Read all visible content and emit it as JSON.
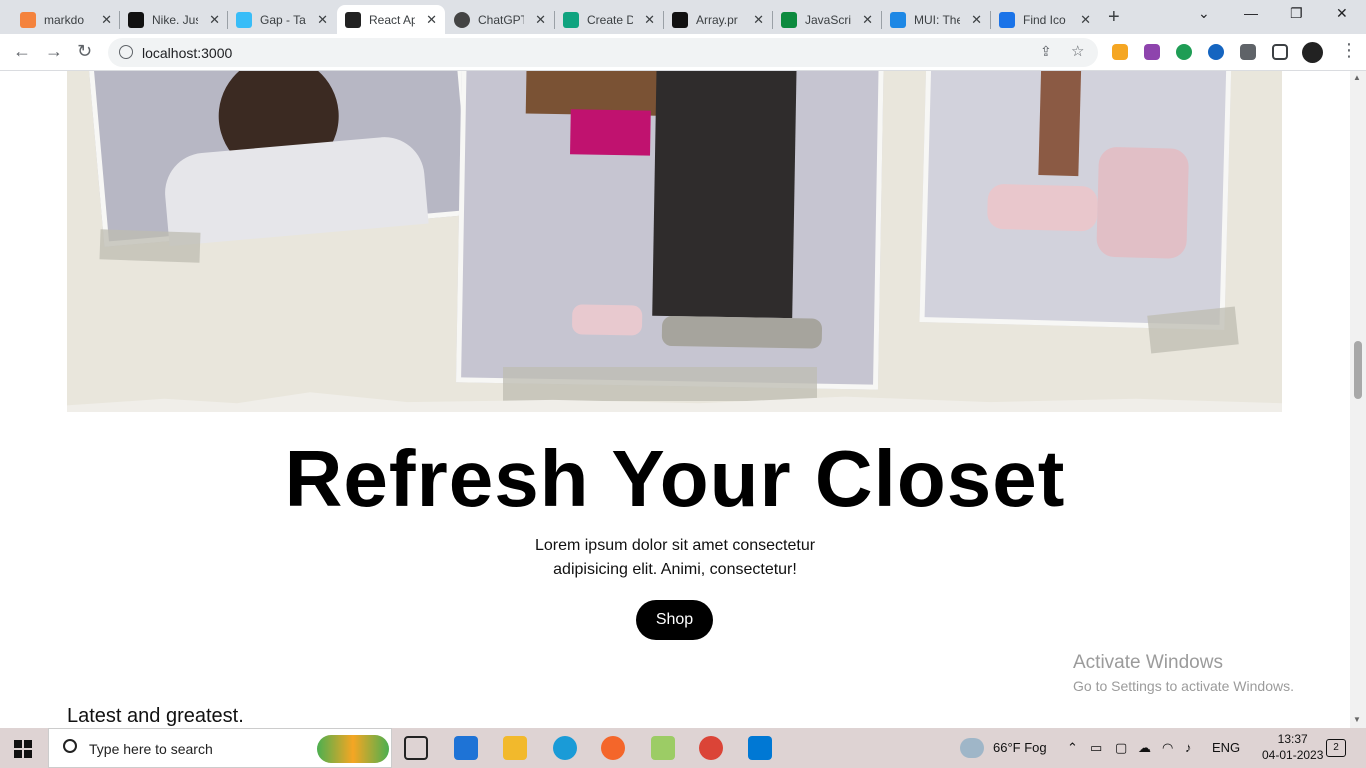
{
  "browser": {
    "tabs": [
      {
        "label": "markdo",
        "color": "#f4833d"
      },
      {
        "label": "Nike. Jus",
        "color": "#111111"
      },
      {
        "label": "Gap - Ta",
        "color": "#38bdf8"
      },
      {
        "label": "React Ap",
        "color": "#222222"
      },
      {
        "label": "ChatGPT",
        "color": "#444444"
      },
      {
        "label": "Create D",
        "color": "#10a37f"
      },
      {
        "label": "Array.pr",
        "color": "#111111"
      },
      {
        "label": "JavaScrip",
        "color": "#0c8a3e"
      },
      {
        "label": "MUI: The",
        "color": "#1e88e5"
      },
      {
        "label": "Find Ico",
        "color": "#1a73e8"
      }
    ],
    "url": "localhost:3000"
  },
  "page": {
    "hero_title": "Refresh Your Closet",
    "subtitle_line1": "Lorem ipsum dolor sit amet consectetur",
    "subtitle_line2": "adipisicing elit. Animi, consectetur!",
    "shop_label": "Shop",
    "section_title": "Latest and greatest."
  },
  "watermark": {
    "line1": "Activate Windows",
    "line2": "Go to Settings to activate Windows."
  },
  "taskbar": {
    "search_placeholder": "Type here to search",
    "weather": "66°F  Fog",
    "language": "ENG",
    "time": "13:37",
    "date": "04-01-2023",
    "notifications": "2"
  }
}
